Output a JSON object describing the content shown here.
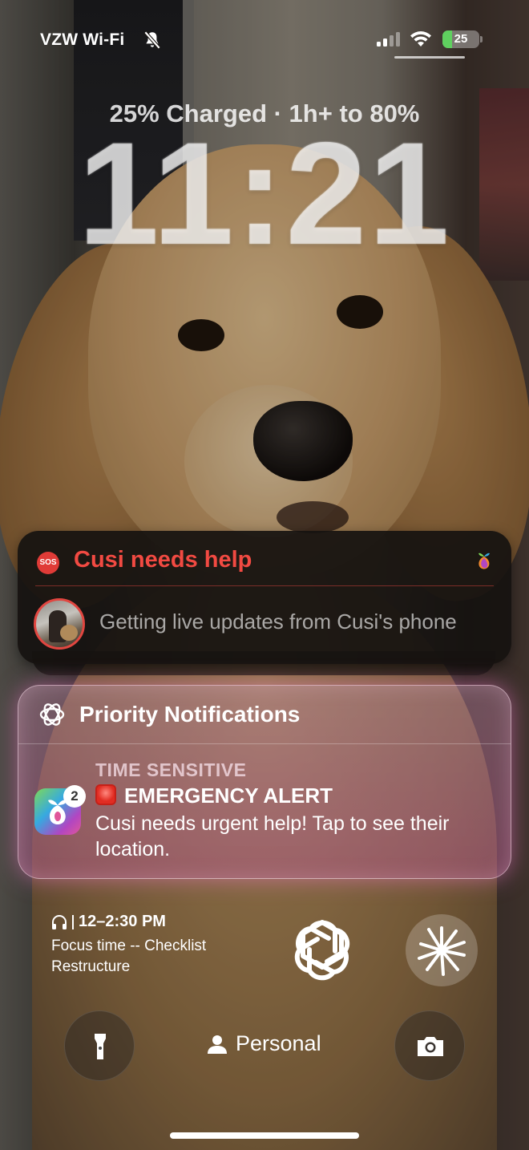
{
  "status_bar": {
    "carrier": "VZW Wi-Fi",
    "silent_icon": "bell-slash-icon",
    "signal_bars": 2,
    "signal_bars_total": 4,
    "wifi_icon": "wifi-icon",
    "battery_percent": 25,
    "battery_label": "25"
  },
  "lock_screen": {
    "charge_status": "25% Charged · 1h+ to 80%",
    "time": "11:21"
  },
  "sos_notification": {
    "badge": "SOS",
    "title": "Cusi needs help",
    "body": "Getting live updates from Cusi's phone",
    "title_color": "#f24a42"
  },
  "priority_notifications": {
    "header": "Priority Notifications",
    "label": "TIME SENSITIVE",
    "badge_count": "2",
    "title": "EMERGENCY ALERT",
    "body": "Cusi needs urgent help! Tap to see their location.",
    "glow_color": "#f078c8"
  },
  "widgets": {
    "calendar": {
      "time": "12–2:30 PM",
      "event": "Focus time -- Checklist Restructure"
    },
    "chatgpt_icon": "openai-logo-icon",
    "claude_icon": "claude-starburst-icon"
  },
  "bottom": {
    "focus_label": "Personal",
    "flashlight_icon": "flashlight-icon",
    "camera_icon": "camera-icon"
  }
}
